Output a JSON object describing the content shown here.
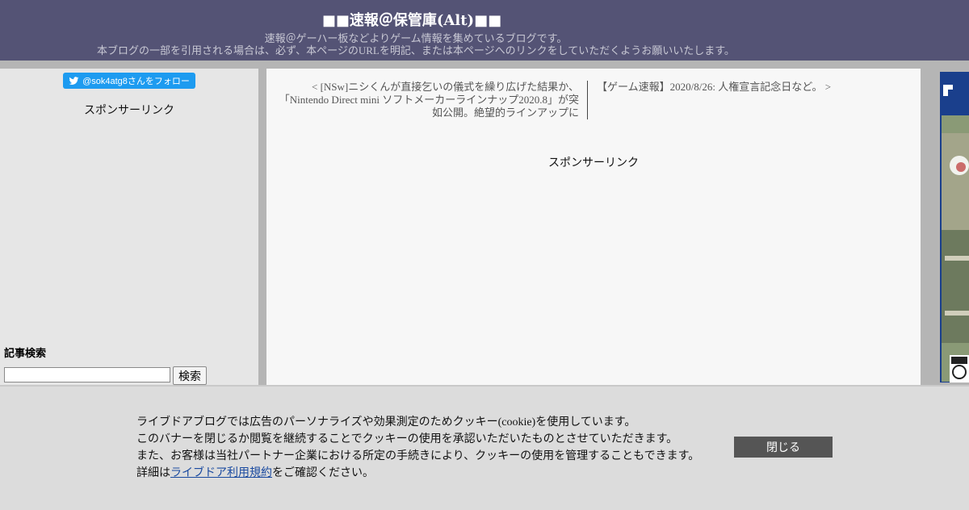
{
  "header": {
    "title": "■■速報＠保管庫(Alt)■■",
    "description_line1": "速報＠ゲーハー板などよりゲーム情報を集めているブログです。",
    "description_line2": "本ブログの一部を引用される場合は、必ず、本ページのURLを明記、または本ページへのリンクをしていただくようお願いいたします。"
  },
  "sidebar": {
    "follow_button": "@sok4atg8さんをフォロー",
    "sponsor_label": "スポンサーリンク",
    "search_heading": "記事検索",
    "search_value": "",
    "search_button": "検索"
  },
  "main": {
    "prev_article": "< [NSw]ニシくんが直接乞いの儀式を繰り広げた結果か、「Nintendo Direct mini ソフトメーカーラインナップ2020.8」が突如公開。絶望的ラインアップに",
    "next_article": "【ゲーム速報】2020/8/26: 人権宣言記念日など。 >",
    "sponsor_label": "スポンサーリンク"
  },
  "right_ad": {
    "icon": "game-box-art"
  },
  "cookie_banner": {
    "line1": "ライブドアブログでは広告のパーソナライズや効果測定のためクッキー(cookie)を使用しています。",
    "line2": "このバナーを閉じるか閲覧を継続することでクッキーの使用を承認いただいたものとさせていただきます。",
    "line3": "また、お客様は当社パートナー企業における所定の手続きにより、クッキーの使用を管理することもできます。",
    "line4_prefix": "詳細は",
    "line4_link": "ライブドア利用規約",
    "line4_suffix": "をご確認ください。",
    "close_button": "閉じる"
  },
  "colors": {
    "header_bg": "#545375",
    "sidebar_bg": "#e6e6e6",
    "main_bg": "#f7f7f7",
    "follow_button_bg": "#1d9bf0",
    "close_button_bg": "#555555",
    "link": "#1a4aa0"
  }
}
